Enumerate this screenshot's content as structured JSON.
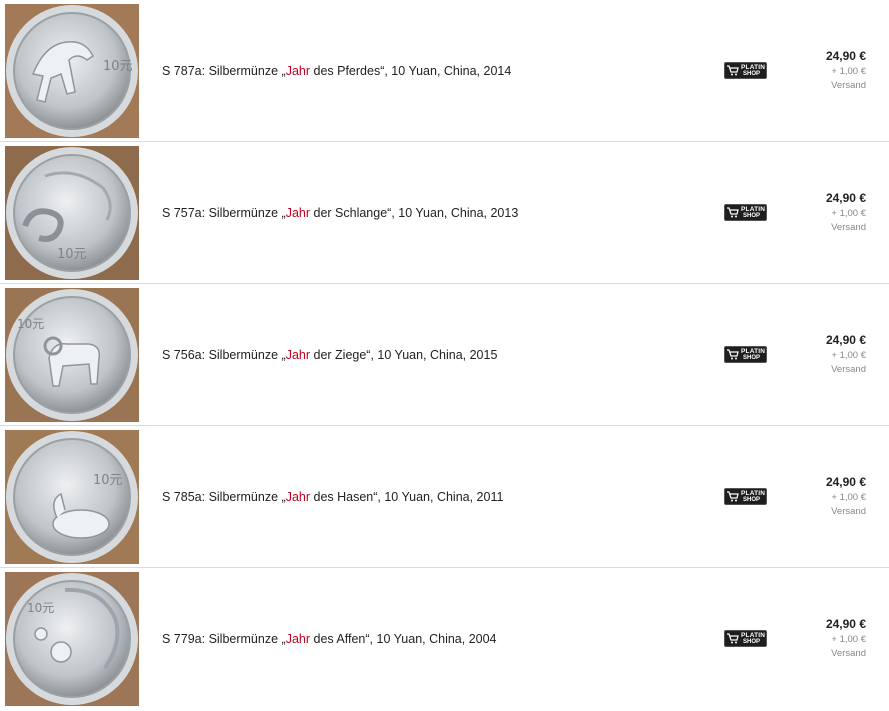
{
  "listings": [
    {
      "title_prefix": "S 787a: Silbermünze „",
      "title_highlight": "Jahr",
      "title_suffix": " des Pferdes“, 10 Yuan, China, 2014",
      "coin_icon": "horse-coin-image",
      "coin_denomination": "10元",
      "badge_line1": "PLATIN",
      "badge_line2": "SHOP",
      "price": "24,90 €",
      "shipping": "+ 1,00 €",
      "shipping_label": "Versand"
    },
    {
      "title_prefix": "S 757a: Silbermünze „",
      "title_highlight": "Jahr",
      "title_suffix": " der Schlange“, 10 Yuan, China, 2013",
      "coin_icon": "snake-coin-image",
      "coin_denomination": "10元",
      "badge_line1": "PLATIN",
      "badge_line2": "SHOP",
      "price": "24,90 €",
      "shipping": "+ 1,00 €",
      "shipping_label": "Versand"
    },
    {
      "title_prefix": "S 756a: Silbermünze „",
      "title_highlight": "Jahr",
      "title_suffix": " der Ziege“, 10 Yuan, China, 2015",
      "coin_icon": "goat-coin-image",
      "coin_denomination": "10元",
      "badge_line1": "PLATIN",
      "badge_line2": "SHOP",
      "price": "24,90 €",
      "shipping": "+ 1,00 €",
      "shipping_label": "Versand"
    },
    {
      "title_prefix": "S 785a: Silbermünze „",
      "title_highlight": "Jahr",
      "title_suffix": " des Hasen“, 10 Yuan, China, 2011",
      "coin_icon": "rabbit-coin-image",
      "coin_denomination": "10元",
      "badge_line1": "PLATIN",
      "badge_line2": "SHOP",
      "price": "24,90 €",
      "shipping": "+ 1,00 €",
      "shipping_label": "Versand"
    },
    {
      "title_prefix": "S 779a: Silbermünze „",
      "title_highlight": "Jahr",
      "title_suffix": " des Affen“, 10 Yuan, China, 2004",
      "coin_icon": "monkey-coin-image",
      "coin_denomination": "10元",
      "badge_line1": "PLATIN",
      "badge_line2": "SHOP",
      "price": "24,90 €",
      "shipping": "+ 1,00 €",
      "shipping_label": "Versand"
    }
  ],
  "colors": {
    "highlight": "#c0001f",
    "price": "#222222",
    "muted": "#888888",
    "badge_bg": "#1e1e1e"
  }
}
